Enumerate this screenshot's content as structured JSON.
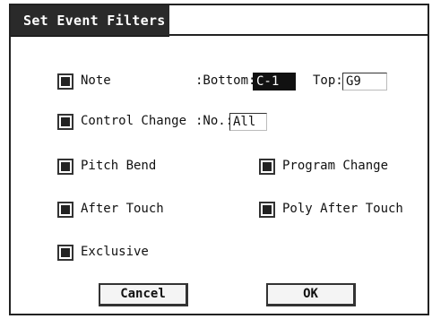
{
  "dialog": {
    "title": "Set Event Filters"
  },
  "filters": {
    "note": {
      "label": "Note",
      "checked": true
    },
    "control_change": {
      "label": "Control Change",
      "checked": true
    },
    "pitch_bend": {
      "label": "Pitch Bend",
      "checked": true
    },
    "program_change": {
      "label": "Program Change",
      "checked": true
    },
    "after_touch": {
      "label": "After Touch",
      "checked": true
    },
    "poly_after_touch": {
      "label": "Poly After Touch",
      "checked": true
    },
    "exclusive": {
      "label": "Exclusive",
      "checked": true
    }
  },
  "note_range": {
    "bottom_label": ":Bottom:",
    "bottom_value": "C-1",
    "top_label": "Top:",
    "top_value": "G9"
  },
  "control_change_no": {
    "label": ":No.:",
    "value": "All"
  },
  "buttons": {
    "cancel": "Cancel",
    "ok": "OK"
  }
}
